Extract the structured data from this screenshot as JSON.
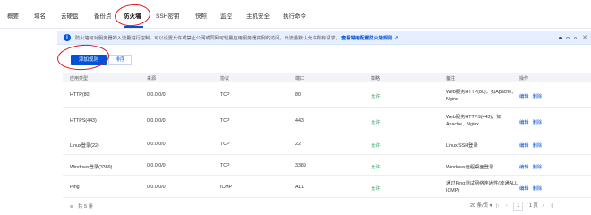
{
  "tabs": [
    {
      "label": "概要"
    },
    {
      "label": "域名"
    },
    {
      "label": "云硬盘"
    },
    {
      "label": "备份点"
    },
    {
      "label": "防火墙"
    },
    {
      "label": "SSH密钥"
    },
    {
      "label": "快照"
    },
    {
      "label": "监控"
    },
    {
      "label": "主机安全"
    },
    {
      "label": "执行命令"
    }
  ],
  "notice": {
    "text": "防火墙可对服务器的入流量进行控制，可以设置允许或禁止公网或同网可轻量应用服务器实例的访问。出流量默认允许所有请求。",
    "link": "查看常用配置防火墙规则",
    "info_icon": "info-icon",
    "ext_icon": "external-link-icon"
  },
  "toolbar": {
    "add_rule": "添加规则",
    "sort": "排序"
  },
  "table": {
    "headers": [
      "应用类型",
      "来源",
      "协议",
      "端口",
      "策略",
      "备注",
      "操作"
    ],
    "rows": [
      {
        "app": "HTTP(80)",
        "source": "0.0.0.0/0",
        "protocol": "TCP",
        "port": "80",
        "policy": "允许",
        "note": "Web服务HTTP(80)，如Apache、Nginx",
        "edit": "编辑",
        "delete": "删除"
      },
      {
        "app": "HTTPS(443)",
        "source": "0.0.0.0/0",
        "protocol": "TCP",
        "port": "443",
        "policy": "允许",
        "note": "Web服务HTTPS(443)，如Apache、Nginx",
        "edit": "编辑",
        "delete": "删除"
      },
      {
        "app": "Linux登录(22)",
        "source": "0.0.0.0/0",
        "protocol": "TCP",
        "port": "22",
        "policy": "允许",
        "note": "Linux SSH登录",
        "edit": "编辑",
        "delete": "删除"
      },
      {
        "app": "Windows登录(3389)",
        "source": "0.0.0.0/0",
        "protocol": "TCP",
        "port": "3389",
        "policy": "允许",
        "note": "Windows远程桌面登录",
        "edit": "编辑",
        "delete": "删除"
      },
      {
        "app": "Ping",
        "source": "0.0.0.0/0",
        "protocol": "ICMP",
        "port": "ALL",
        "policy": "允许",
        "note": "通过Ping测试网络连通性(放通ALL ICMP)",
        "edit": "编辑",
        "delete": "删除"
      }
    ]
  },
  "footer": {
    "total_label": "共 5 条",
    "page_size": "20",
    "page_size_suffix": "条/页",
    "current_page": "1",
    "page_total": "/ 1 页"
  },
  "colors": {
    "primary": "#0052d9",
    "allow": "#2aa361",
    "annotation": "#e0151b"
  }
}
